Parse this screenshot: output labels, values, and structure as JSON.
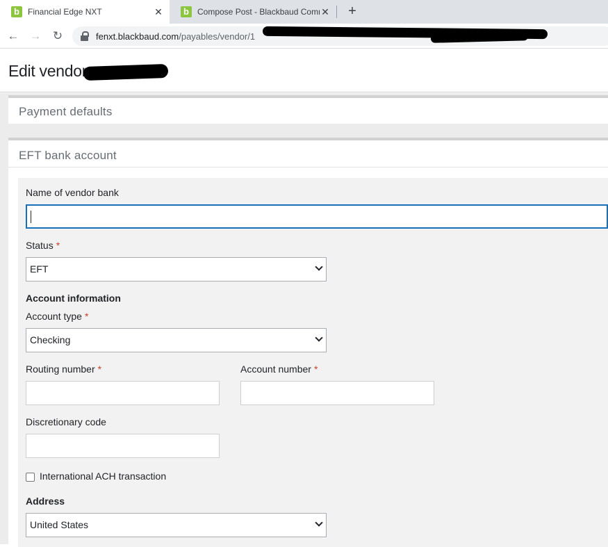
{
  "browser": {
    "tabs": [
      {
        "title": "Financial Edge NXT",
        "favicon": "b",
        "active": true
      },
      {
        "title": "Compose Post - Blackbaud Comm",
        "favicon": "b",
        "active": false
      }
    ],
    "new_tab_label": "+",
    "close_glyph": "✕",
    "url_host": "fenxt.blackbaud.com",
    "url_path": "/payables/vendor/1"
  },
  "page": {
    "title": "Edit vendor"
  },
  "sections": {
    "payment_defaults": {
      "heading": "Payment defaults"
    },
    "eft_bank_account": {
      "heading": "EFT bank account",
      "fields": {
        "vendor_bank_name": {
          "label": "Name of vendor bank",
          "value": ""
        },
        "status": {
          "label": "Status",
          "required_mark": "*",
          "selected": "EFT"
        },
        "account_information_heading": "Account information",
        "account_type": {
          "label": "Account type",
          "required_mark": "*",
          "selected": "Checking"
        },
        "routing_number": {
          "label": "Routing number",
          "required_mark": "*",
          "value": ""
        },
        "account_number": {
          "label": "Account number",
          "required_mark": "*",
          "value": ""
        },
        "discretionary_code": {
          "label": "Discretionary code",
          "value": ""
        },
        "international_ach": {
          "label": "International ACH transaction",
          "checked": false
        },
        "address_heading": "Address",
        "country": {
          "selected": "United States"
        }
      }
    }
  },
  "colors": {
    "accent_focus": "#1870b8",
    "required": "#c7412b",
    "favicon": "#8cc63f"
  }
}
